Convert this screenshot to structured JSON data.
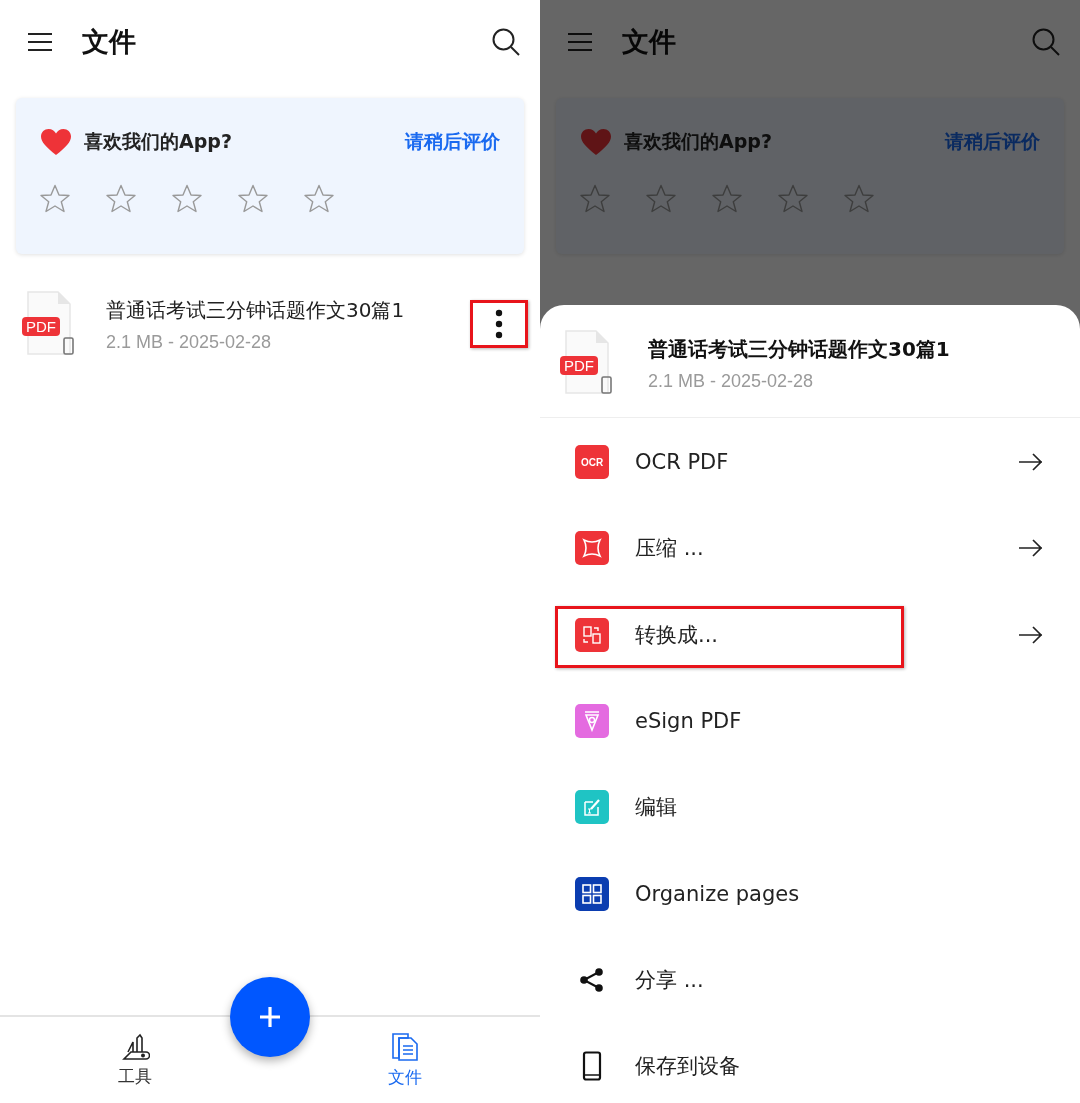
{
  "screens": [
    {
      "dimmed": false,
      "header": {
        "title": "文件"
      },
      "rating_card": {
        "question": "喜欢我们的App?",
        "action": "请稍后评价",
        "stars": 0
      },
      "files": [
        {
          "name": "普通话考试三分钟话题作文30篇1",
          "meta": "2.1 MB - 2025-02-28",
          "badge": "PDF",
          "more_highlighted": true
        }
      ],
      "bottom_nav": [
        {
          "kind": "tools",
          "label": "工具",
          "selected": false
        },
        {
          "kind": "files",
          "label": "文件",
          "selected": true
        }
      ]
    },
    {
      "dimmed": true,
      "header": {
        "title": "文件"
      },
      "rating_card": {
        "question": "喜欢我们的App?",
        "action": "请稍后评价",
        "stars": 0
      }
    }
  ],
  "action_sheet": {
    "file": {
      "name": "普通话考试三分钟话题作文30篇1",
      "meta": "2.1 MB - 2025-02-28",
      "badge": "PDF"
    },
    "items": [
      {
        "kind": "ocr",
        "icon_text": "OCR",
        "label": "OCR PDF",
        "color": "#ee3338",
        "arrow": true,
        "highlighted": false
      },
      {
        "kind": "compress",
        "label": "压缩 ...",
        "color": "#ee3338",
        "arrow": true,
        "highlighted": false
      },
      {
        "kind": "convert",
        "label": "转换成...",
        "color": "#ee3338",
        "arrow": true,
        "highlighted": true
      },
      {
        "kind": "esign",
        "label": "eSign PDF",
        "color": "#e46be0",
        "arrow": false,
        "highlighted": false
      },
      {
        "kind": "edit",
        "label": "编辑",
        "color": "#1fc4c4",
        "arrow": false,
        "highlighted": false
      },
      {
        "kind": "organize",
        "label": "Organize pages",
        "color": "#0b3db0",
        "arrow": false,
        "highlighted": false
      },
      {
        "kind": "share",
        "label": "分享 ...",
        "arrow": false,
        "highlighted": false
      },
      {
        "kind": "device",
        "label": "保存到设备",
        "arrow": false,
        "highlighted": false
      }
    ]
  }
}
